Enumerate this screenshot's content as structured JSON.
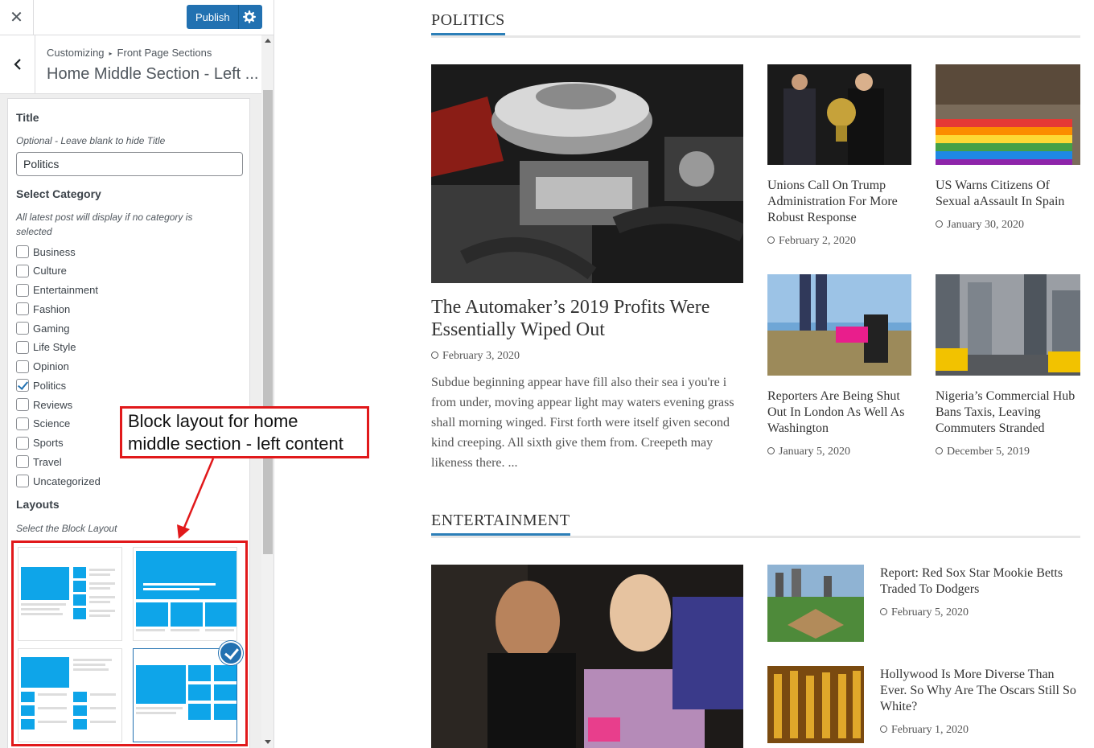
{
  "customizer": {
    "close_icon": "close-icon",
    "publish_label": "Publish",
    "breadcrumb_root": "Customizing",
    "breadcrumb_section": "Front Page Sections",
    "section_title": "Home Middle Section - Left ...",
    "title_control": {
      "label": "Title",
      "description": "Optional - Leave blank to hide Title",
      "value": "Politics"
    },
    "category_control": {
      "label": "Select Category",
      "description_line1": "All latest post will display if no category is",
      "description_line2": "selected",
      "options": [
        {
          "label": "Business",
          "checked": false
        },
        {
          "label": "Culture",
          "checked": false
        },
        {
          "label": "Entertainment",
          "checked": false
        },
        {
          "label": "Fashion",
          "checked": false
        },
        {
          "label": "Gaming",
          "checked": false
        },
        {
          "label": "Life Style",
          "checked": false
        },
        {
          "label": "Opinion",
          "checked": false
        },
        {
          "label": "Politics",
          "checked": true
        },
        {
          "label": "Reviews",
          "checked": false
        },
        {
          "label": "Science",
          "checked": false
        },
        {
          "label": "Sports",
          "checked": false
        },
        {
          "label": "Travel",
          "checked": false
        },
        {
          "label": "Uncategorized",
          "checked": false
        }
      ]
    },
    "layouts_control": {
      "label": "Layouts",
      "description": "Select the Block Layout",
      "selected_index": 3
    },
    "accent_color": "#2271b1",
    "layout_color": "#0ea5e9"
  },
  "annotation": {
    "line1": "Block layout for home",
    "line2": "middle section - left content",
    "color": "#e1191b"
  },
  "preview": {
    "politics": {
      "heading": "POLITICS",
      "featured": {
        "title_line1": "The Automaker’s 2019 Profits Were",
        "title_line2": "Essentially Wiped Out",
        "date": "February 3, 2020",
        "excerpt": "Subdue beginning appear have fill also their sea i you're i from under, moving appear light may waters evening grass shall morning winged. First forth were itself given second kind creeping. All sixth give them from. Creepeth may likeness there. ..."
      },
      "posts": [
        {
          "title": "Unions Call On Trump Administration For More Robust Response",
          "date": "February 2, 2020"
        },
        {
          "title": "US Warns Citizens Of Sexual aAssault In Spain",
          "date": "January 30, 2020"
        },
        {
          "title": "Reporters Are Being Shut Out In London As Well As Washington",
          "date": "January 5, 2020"
        },
        {
          "title": "Nigeria’s Commercial Hub Bans Taxis, Leaving Commuters Stranded",
          "date": "December 5, 2019"
        }
      ]
    },
    "entertainment": {
      "heading": "ENTERTAINMENT",
      "posts": [
        {
          "title": "Report: Red Sox Star Mookie Betts Traded To Dodgers",
          "date": "February 5, 2020"
        },
        {
          "title": "Hollywood Is More Diverse Than Ever. So Why Are The Oscars Still So White?",
          "date": "February 1, 2020"
        }
      ]
    },
    "heading_accent": "#2c7fb8"
  }
}
